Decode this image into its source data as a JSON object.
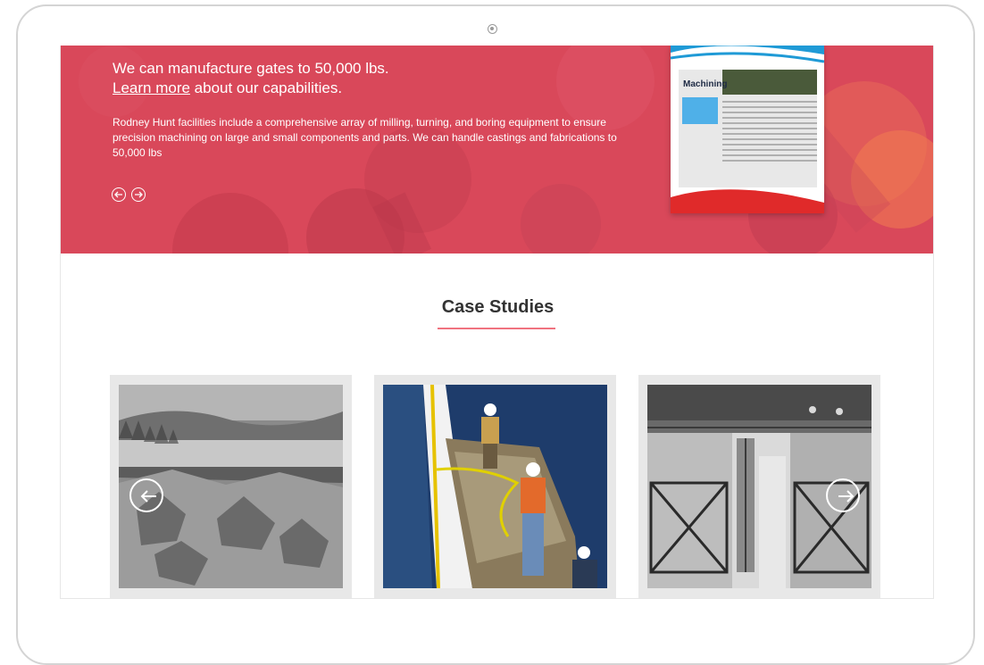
{
  "hero": {
    "headline": "We can manufacture gates to 50,000 lbs.",
    "link_text": "Learn more",
    "link_suffix": " about our capabilities.",
    "body": "Rodney Hunt facilities include a comprehensive array of milling, turning, and boring equipment to ensure precision machining on large and small components and parts. We can handle castings and fabrications to 50,000 lbs",
    "background_color": "#d9485a",
    "brochure_title": "Machining"
  },
  "section": {
    "title": "Case Studies",
    "underline_color": "#f0727f"
  },
  "icons": {
    "prev": "arrow-left-circle-icon",
    "next": "arrow-right-circle-icon",
    "camera": "camera-icon"
  }
}
